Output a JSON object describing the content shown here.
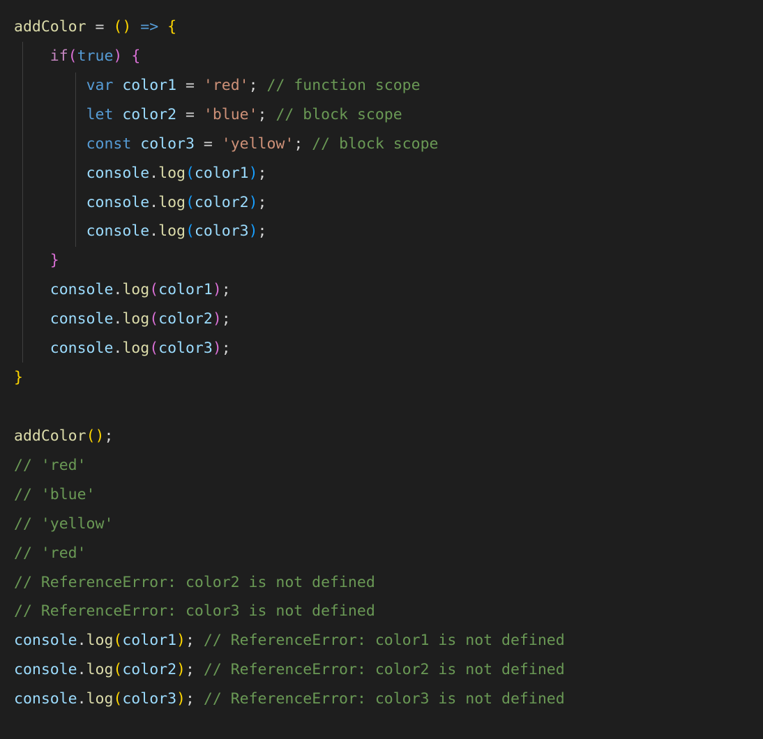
{
  "code": {
    "l1": {
      "fn": "addColor",
      "eq": " = ",
      "lp": "(",
      "rp": ")",
      "arrow": " => ",
      "brace": "{"
    },
    "l2": {
      "indent": "    ",
      "if": "if",
      "lp": "(",
      "true": "true",
      "rp": ")",
      "sp": " ",
      "brace": "{"
    },
    "l3": {
      "indent": "        ",
      "kw": "var",
      "sp": " ",
      "id": "color1",
      "eq": " = ",
      "str": "'red'",
      "semi": ";",
      "csp": " ",
      "cmt": "// function scope"
    },
    "l4": {
      "indent": "        ",
      "kw": "let",
      "sp": " ",
      "id": "color2",
      "eq": " = ",
      "str": "'blue'",
      "semi": ";",
      "csp": " ",
      "cmt": "// block scope"
    },
    "l5": {
      "indent": "        ",
      "kw": "const",
      "sp": " ",
      "id": "color3",
      "eq": " = ",
      "str": "'yellow'",
      "semi": ";",
      "csp": " ",
      "cmt": "// block scope"
    },
    "l6": {
      "indent": "        ",
      "obj": "console",
      "dot": ".",
      "m": "log",
      "lp": "(",
      "arg": "color1",
      "rp": ")",
      "semi": ";"
    },
    "l7": {
      "indent": "        ",
      "obj": "console",
      "dot": ".",
      "m": "log",
      "lp": "(",
      "arg": "color2",
      "rp": ")",
      "semi": ";"
    },
    "l8": {
      "indent": "        ",
      "obj": "console",
      "dot": ".",
      "m": "log",
      "lp": "(",
      "arg": "color3",
      "rp": ")",
      "semi": ";"
    },
    "l9": {
      "indent": "    ",
      "brace": "}"
    },
    "l10": {
      "indent": "    ",
      "obj": "console",
      "dot": ".",
      "m": "log",
      "lp": "(",
      "arg": "color1",
      "rp": ")",
      "semi": ";"
    },
    "l11": {
      "indent": "    ",
      "obj": "console",
      "dot": ".",
      "m": "log",
      "lp": "(",
      "arg": "color2",
      "rp": ")",
      "semi": ";"
    },
    "l12": {
      "indent": "    ",
      "obj": "console",
      "dot": ".",
      "m": "log",
      "lp": "(",
      "arg": "color3",
      "rp": ")",
      "semi": ";"
    },
    "l13": {
      "brace": "}"
    },
    "l14": {
      "blank": " "
    },
    "l15": {
      "fn": "addColor",
      "lp": "(",
      "rp": ")",
      "semi": ";"
    },
    "l16": {
      "cmt": "// 'red'"
    },
    "l17": {
      "cmt": "// 'blue'"
    },
    "l18": {
      "cmt": "// 'yellow'"
    },
    "l19": {
      "cmt": "// 'red'"
    },
    "l20": {
      "cmt": "// ReferenceError: color2 is not defined"
    },
    "l21": {
      "cmt": "// ReferenceError: color3 is not defined"
    },
    "l22": {
      "obj": "console",
      "dot": ".",
      "m": "log",
      "lp": "(",
      "arg": "color1",
      "rp": ")",
      "semi": ";",
      "csp": " ",
      "cmt": "// ReferenceError: color1 is not defined"
    },
    "l23": {
      "obj": "console",
      "dot": ".",
      "m": "log",
      "lp": "(",
      "arg": "color2",
      "rp": ")",
      "semi": ";",
      "csp": " ",
      "cmt": "// ReferenceError: color2 is not defined"
    },
    "l24": {
      "obj": "console",
      "dot": ".",
      "m": "log",
      "lp": "(",
      "arg": "color3",
      "rp": ")",
      "semi": ";",
      "csp": " ",
      "cmt": "// ReferenceError: color3 is not defined"
    }
  }
}
